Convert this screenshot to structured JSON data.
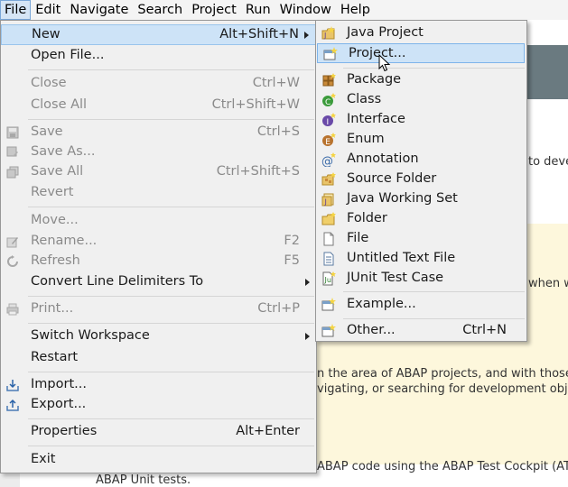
{
  "menubar": {
    "items": [
      "File",
      "Edit",
      "Navigate",
      "Search",
      "Project",
      "Run",
      "Window",
      "Help"
    ]
  },
  "file_menu": {
    "new": {
      "label": "New",
      "accel": "Alt+Shift+N"
    },
    "open_file": {
      "label": "Open File..."
    },
    "close": {
      "label": "Close",
      "accel": "Ctrl+W"
    },
    "close_all": {
      "label": "Close All",
      "accel": "Ctrl+Shift+W"
    },
    "save": {
      "label": "Save",
      "accel": "Ctrl+S"
    },
    "save_as": {
      "label": "Save As..."
    },
    "save_all": {
      "label": "Save All",
      "accel": "Ctrl+Shift+S"
    },
    "revert": {
      "label": "Revert"
    },
    "move": {
      "label": "Move..."
    },
    "rename": {
      "label": "Rename...",
      "accel": "F2"
    },
    "refresh": {
      "label": "Refresh",
      "accel": "F5"
    },
    "convert": {
      "label": "Convert Line Delimiters To"
    },
    "print": {
      "label": "Print...",
      "accel": "Ctrl+P"
    },
    "switch_workspace": {
      "label": "Switch Workspace"
    },
    "restart": {
      "label": "Restart"
    },
    "import": {
      "label": "Import..."
    },
    "export": {
      "label": "Export..."
    },
    "properties": {
      "label": "Properties",
      "accel": "Alt+Enter"
    },
    "exit": {
      "label": "Exit"
    }
  },
  "new_submenu": {
    "java_project": "Java Project",
    "project": "Project...",
    "package": "Package",
    "class": "Class",
    "interface": "Interface",
    "enum": "Enum",
    "annotation": "Annotation",
    "source_folder": "Source Folder",
    "java_working_set": "Java Working Set",
    "folder": "Folder",
    "file": "File",
    "untitled_text_file": "Untitled Text File",
    "junit_test_case": "JUnit Test Case",
    "example": "Example...",
    "other": {
      "label": "Other...",
      "accel": "Ctrl+N"
    }
  },
  "background": {
    "t1": "to deve",
    "t2": "when w",
    "t3": "n the area of ABAP projects, and with those",
    "t4": "vigating, or searching for development objec",
    "t5": "ABAP code using the ABAP Test Cockpit (ATC",
    "t6": "ABAP Unit tests."
  },
  "colors": {
    "menu_bg": "#f0f0f0",
    "highlight": "#cde3f7",
    "disabled_text": "#8a8a8a",
    "content_yellow": "#fdf7dc"
  }
}
